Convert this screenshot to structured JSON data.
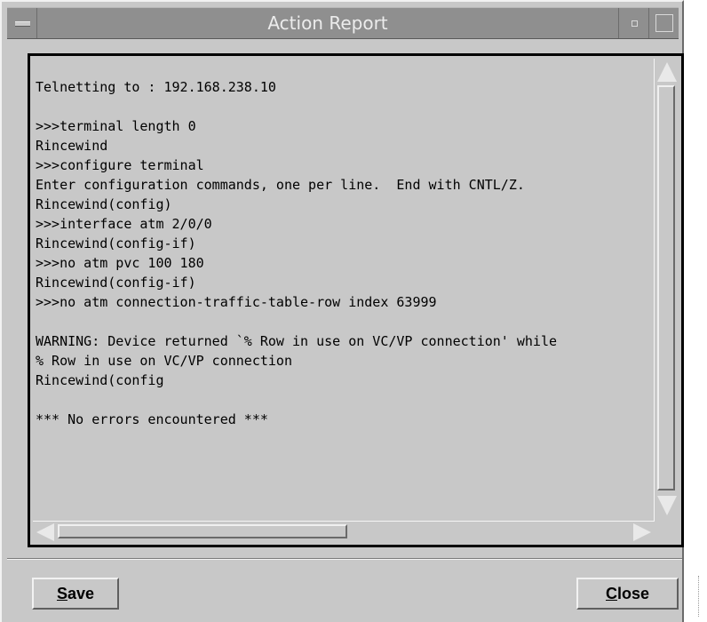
{
  "window": {
    "title": "Action Report"
  },
  "report": {
    "lines": [
      "",
      "Telnetting to : 192.168.238.10",
      "",
      ">>>terminal length 0",
      "Rincewind",
      ">>>configure terminal",
      "Enter configuration commands, one per line.  End with CNTL/Z.",
      "Rincewind(config)",
      ">>>interface atm 2/0/0",
      "Rincewind(config-if)",
      ">>>no atm pvc 100 180",
      "Rincewind(config-if)",
      ">>>no atm connection-traffic-table-row index 63999",
      "",
      "WARNING: Device returned `% Row in use on VC/VP connection' while",
      "% Row in use on VC/VP connection",
      "Rincewind(config",
      "",
      "*** No errors encountered ***"
    ]
  },
  "buttons": {
    "save": {
      "mnemonic": "S",
      "rest": "ave"
    },
    "close": {
      "mnemonic": "C",
      "rest": "lose"
    }
  }
}
